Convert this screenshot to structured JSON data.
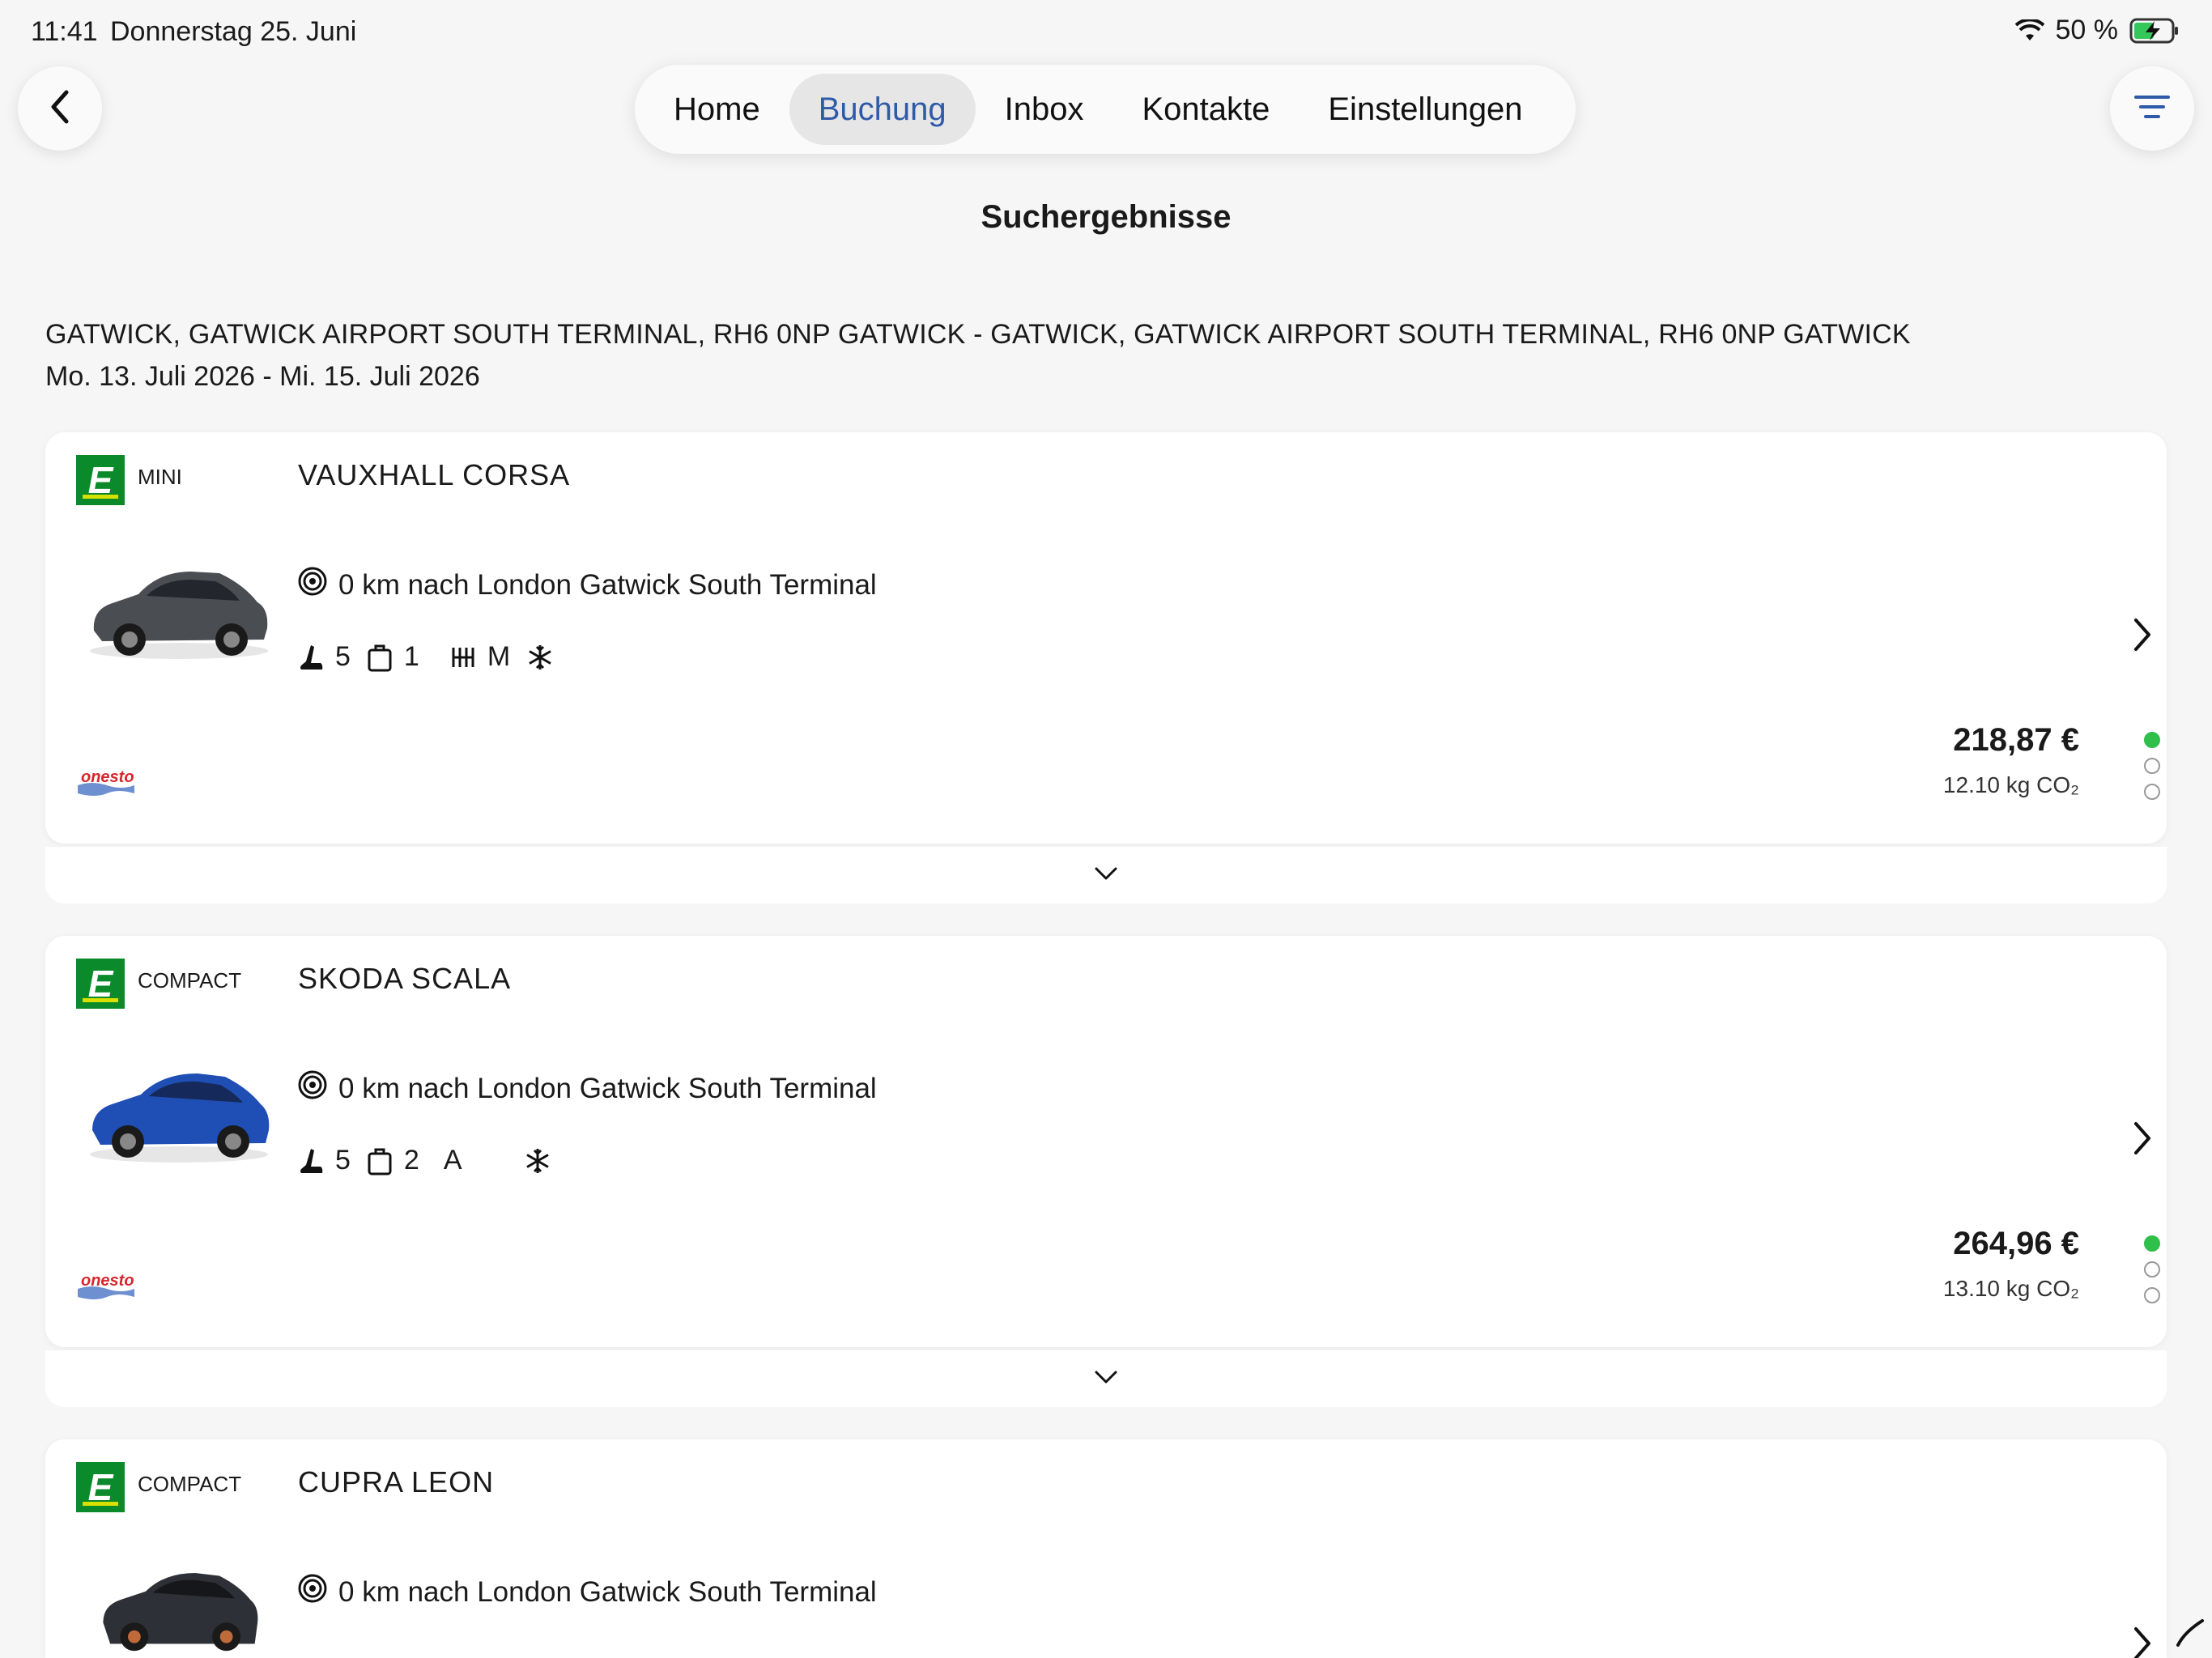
{
  "status": {
    "time": "11:41",
    "date": "Donnerstag 25. Juni",
    "battery": "50 %"
  },
  "nav": {
    "tabs": [
      "Home",
      "Buchung",
      "Inbox",
      "Kontakte",
      "Einstellungen"
    ],
    "active_tab": "Buchung"
  },
  "page": {
    "title": "Suchergebnisse",
    "route": "GATWICK, GATWICK AIRPORT SOUTH TERMINAL, RH6 0NP GATWICK - GATWICK, GATWICK AIRPORT SOUTH TERMINAL, RH6 0NP GATWICK",
    "dates": "Mo. 13. Juli 2026 - Mi. 15. Juli 2026"
  },
  "results": [
    {
      "brand_letter": "E",
      "category": "MINI",
      "model": "VAUXHALL CORSA",
      "car_color": "#4a4d52",
      "distance": "0 km nach London Gatwick South Terminal",
      "seats": "5",
      "bags": "1",
      "transmission": "M",
      "price": "218,87 €",
      "co2": "12.10 kg CO₂",
      "supplier": "onesto",
      "eco_level": 1
    },
    {
      "brand_letter": "E",
      "category": "COMPACT",
      "model": "SKODA SCALA",
      "car_color": "#1f4fb5",
      "distance": "0 km nach London Gatwick South Terminal",
      "seats": "5",
      "bags": "2",
      "transmission": "A",
      "price": "264,96 €",
      "co2": "13.10 kg CO₂",
      "supplier": "onesto",
      "eco_level": 1
    },
    {
      "brand_letter": "E",
      "category": "COMPACT",
      "model": "CUPRA LEON",
      "car_color": "#2d3036",
      "distance": "0 km nach London Gatwick South Terminal"
    }
  ]
}
